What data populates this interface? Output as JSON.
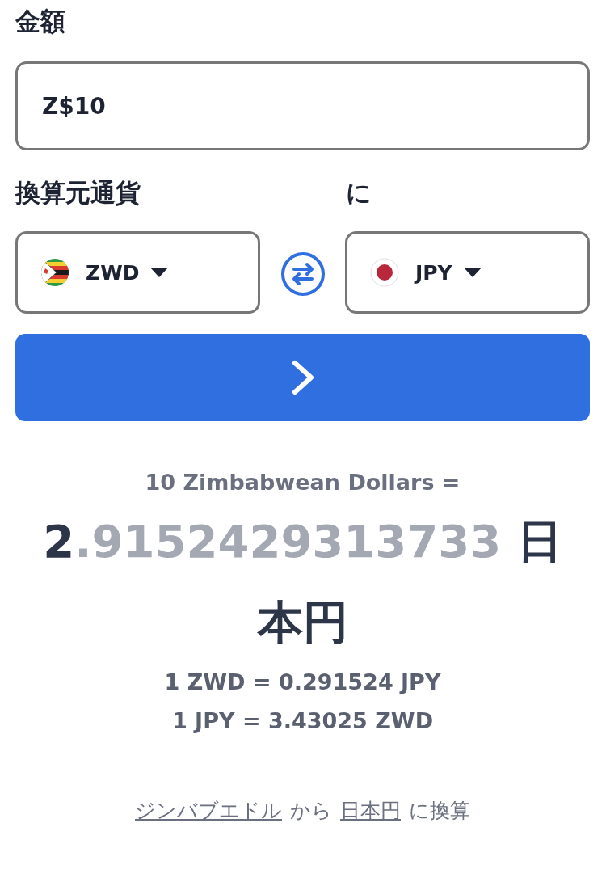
{
  "amount": {
    "label": "金額",
    "value": "Z$10"
  },
  "from": {
    "label": "換算元通貨",
    "currency": "ZWD",
    "flag": {
      "kind": "zw"
    }
  },
  "to": {
    "label": "に",
    "currency": "JPY",
    "flag": {
      "kind": "jp"
    }
  },
  "summary": "10 Zimbabwean Dollars =",
  "result": {
    "whole": "2",
    "fraction": ".9152429313733",
    "currency": "日本円"
  },
  "rates": [
    "1 ZWD = 0.291524 JPY",
    "1 JPY = 3.43025 ZWD"
  ],
  "conversion": [
    {
      "kind": "link",
      "text": "ジンバブエドル"
    },
    {
      "kind": "text",
      "text": "から"
    },
    {
      "kind": "link",
      "text": "日本円"
    },
    {
      "kind": "text",
      "text": "に換算"
    }
  ]
}
